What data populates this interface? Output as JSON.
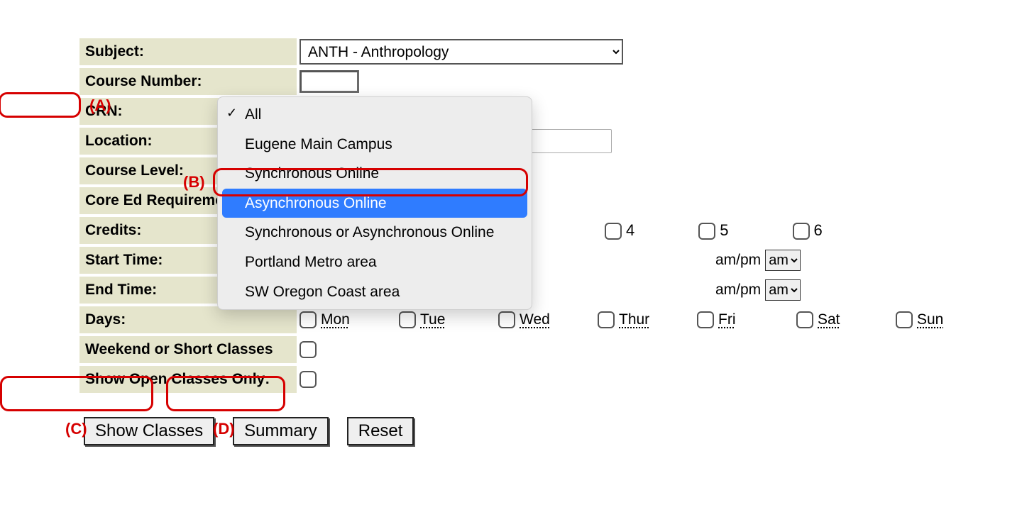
{
  "labels": {
    "subject": "Subject:",
    "course_number": "Course Number:",
    "crn": "CRN:",
    "location": "Location:",
    "course_level": "Course Level:",
    "core_ed": "Core Ed Requirement:",
    "credits": "Credits:",
    "start_time": "Start Time:",
    "end_time": "End Time:",
    "days": "Days:",
    "weekend": "Weekend or Short Classes",
    "open_only": "Show Open Classes Only:"
  },
  "subject_selected": "ANTH - Anthropology",
  "location_popup": {
    "options": [
      "All",
      "Eugene Main Campus",
      "Synchronous Online",
      "Asynchronous Online",
      "Synchronous or Asynchronous Online",
      "Portland Metro area",
      "SW Oregon Coast area"
    ],
    "checked_index": 0,
    "highlight_index": 3
  },
  "credits": {
    "c4": "4",
    "c5": "5",
    "c6": "6"
  },
  "ampm_label": "am/pm",
  "ampm_value": "am",
  "days": {
    "mon": "Mon",
    "tue": "Tue",
    "wed": "Wed",
    "thur": "Thur",
    "fri": "Fri",
    "sat": "Sat",
    "sun": "Sun"
  },
  "buttons": {
    "show": "Show Classes",
    "summary": "Summary",
    "reset": "Reset"
  },
  "annotations": {
    "A": "(A)",
    "B": "(B)",
    "C": "(C)",
    "D": "(D)"
  }
}
